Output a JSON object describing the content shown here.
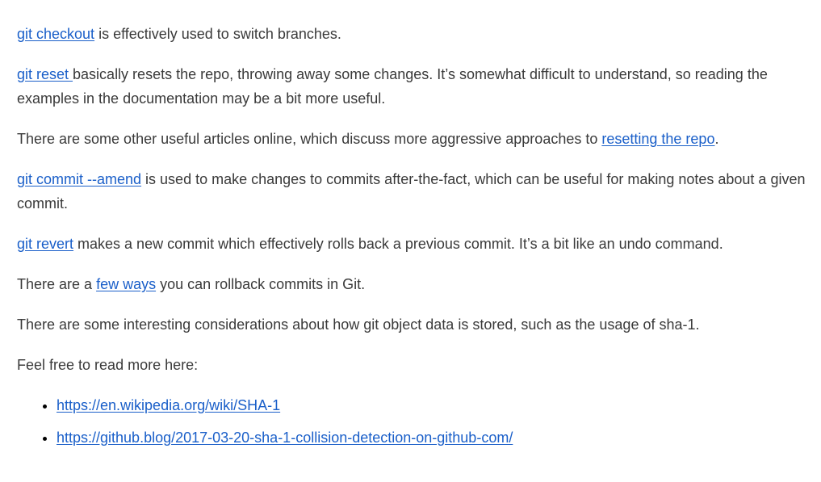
{
  "paragraphs": {
    "checkout": {
      "link": "git checkout",
      "text": " is effectively used to switch branches."
    },
    "reset": {
      "link": "git reset ",
      "text": "basically resets the repo, throwing away some changes. It’s somewhat difficult to understand, so reading the examples in the documentation may be a bit more useful."
    },
    "other_articles": {
      "text_before": "There are some other useful articles online, which discuss more aggressive approaches to ",
      "link": "resetting the repo",
      "text_after": "."
    },
    "amend": {
      "link": "git commit --amend",
      "text": " is used to make changes to commits after-the-fact, which can be useful for making notes about a given commit."
    },
    "revert": {
      "link": "git revert",
      "text": " makes a new commit which effectively rolls back a previous commit. It’s a bit like an undo command."
    },
    "rollback": {
      "text_before": "There are a ",
      "link": "few ways",
      "text_after": " you can rollback commits in Git."
    },
    "sha1": {
      "text": "There are some interesting considerations about how git object data is stored, such as the usage of sha-1."
    },
    "read_more": {
      "text": "Feel free to read more here:"
    }
  },
  "links_list": [
    {
      "label": "https://en.wikipedia.org/wiki/SHA-1"
    },
    {
      "label": "https://github.blog/2017-03-20-sha-1-collision-detection-on-github-com/"
    }
  ],
  "colors": {
    "link": "#1a5fc9",
    "text": "#3a3a3a",
    "background": "#ffffff"
  }
}
